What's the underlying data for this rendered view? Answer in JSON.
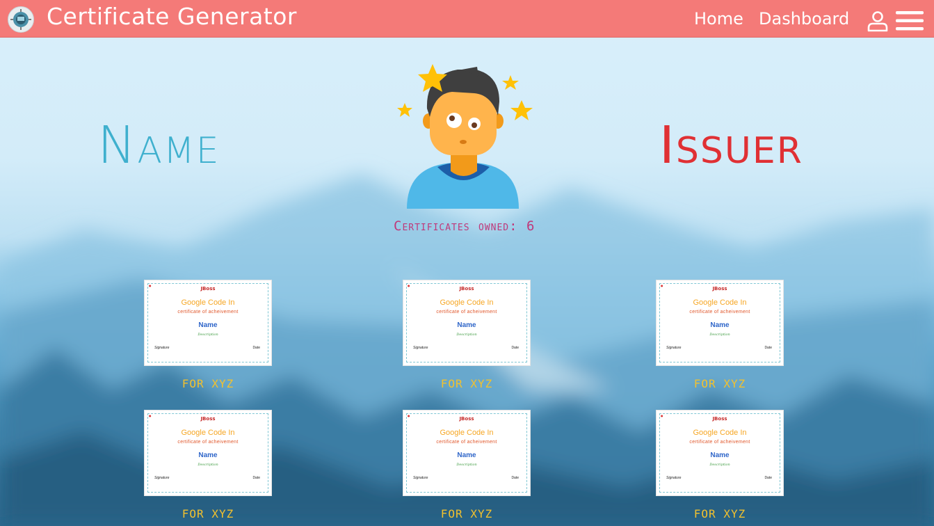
{
  "navbar": {
    "title": "Certificate Generator",
    "links": [
      "Home",
      "Dashboard"
    ],
    "icons": [
      "app-logo-icon",
      "user-icon",
      "hamburger-menu-icon"
    ],
    "color": "#f47a78"
  },
  "profile": {
    "name_label": "Name",
    "issuer_label": "Issuer",
    "owned_text": "Certificates owned: 6",
    "name_color": "#3fb0ce",
    "issuer_color": "#e03034"
  },
  "certificates": [
    {
      "logo": "JBoss",
      "title": "Google Code In",
      "subtitle": "certificate of acheivement",
      "name": "Name",
      "description": "Description",
      "signature": "Signature",
      "date": "Date",
      "caption": "FOR XYZ"
    },
    {
      "logo": "JBoss",
      "title": "Google Code In",
      "subtitle": "certificate of acheivement",
      "name": "Name",
      "description": "Description",
      "signature": "Signature",
      "date": "Date",
      "caption": "FOR XYZ"
    },
    {
      "logo": "JBoss",
      "title": "Google Code In",
      "subtitle": "certificate of acheivement",
      "name": "Name",
      "description": "Description",
      "signature": "Signature",
      "date": "Date",
      "caption": "FOR XYZ"
    },
    {
      "logo": "JBoss",
      "title": "Google Code In",
      "subtitle": "certificate of acheivement",
      "name": "Name",
      "description": "Description",
      "signature": "Signature",
      "date": "Date",
      "caption": "FOR XYZ"
    },
    {
      "logo": "JBoss",
      "title": "Google Code In",
      "subtitle": "certificate of acheivement",
      "name": "Name",
      "description": "Description",
      "signature": "Signature",
      "date": "Date",
      "caption": "FOR XYZ"
    },
    {
      "logo": "JBoss",
      "title": "Google Code In",
      "subtitle": "certificate of acheivement",
      "name": "Name",
      "description": "Description",
      "signature": "Signature",
      "date": "Date",
      "caption": "FOR XYZ"
    }
  ]
}
